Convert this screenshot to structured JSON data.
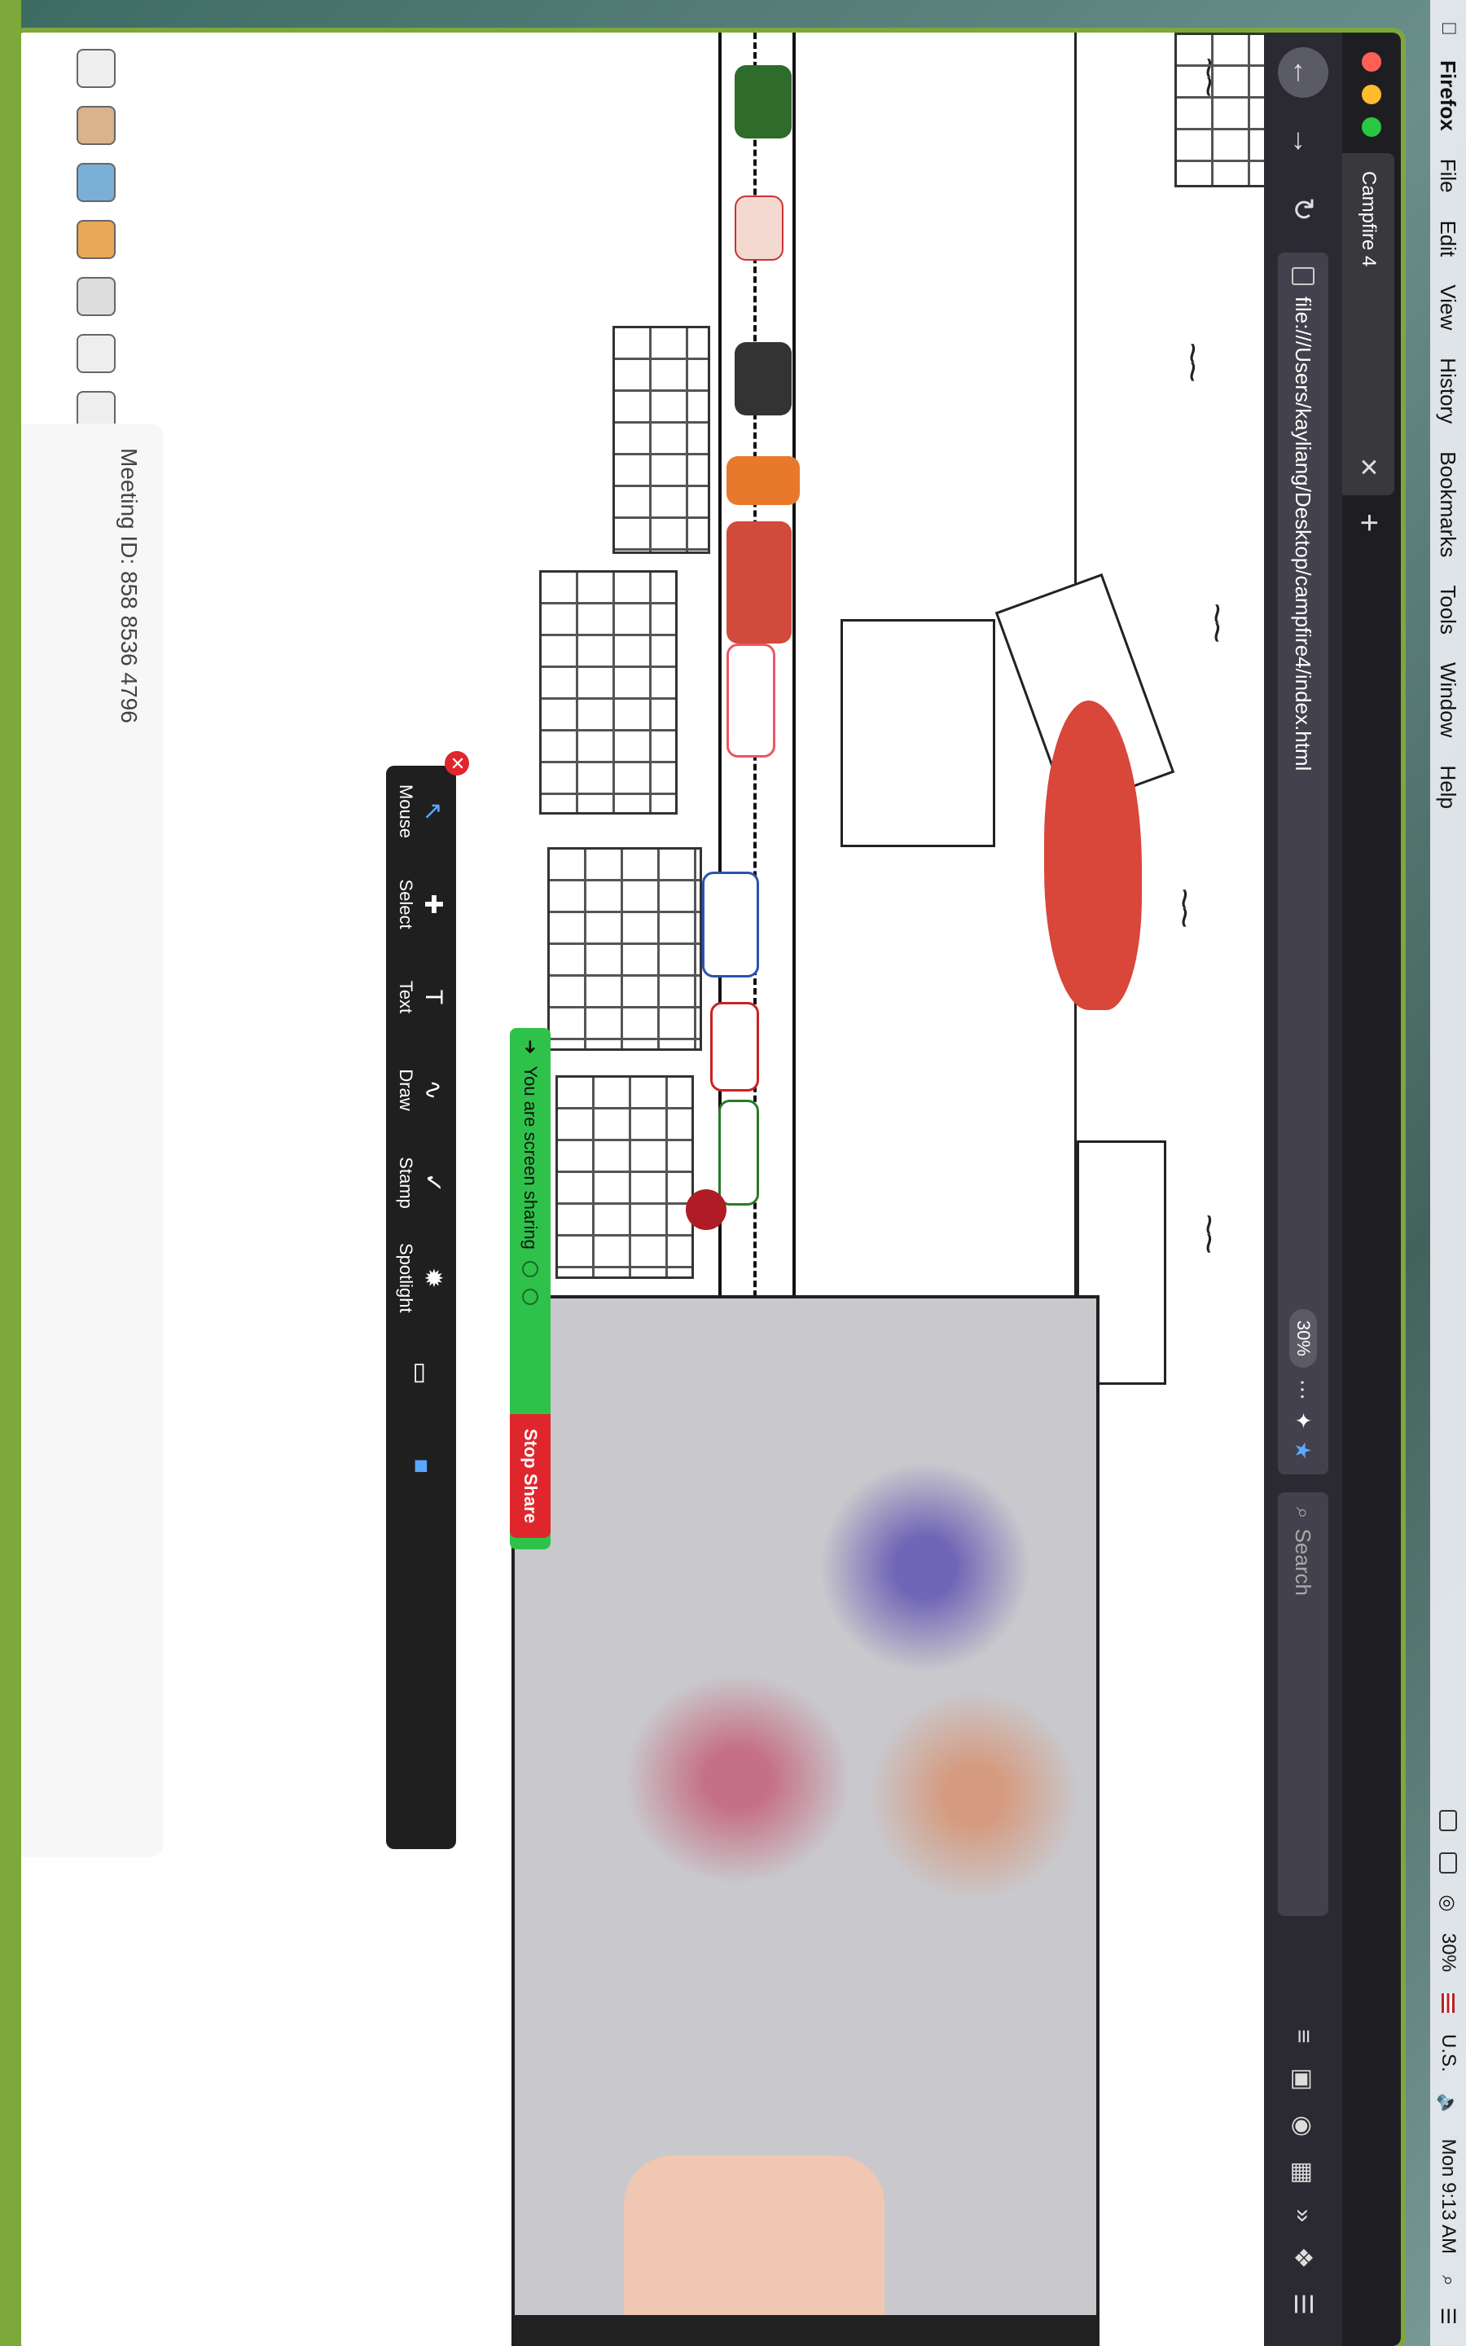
{
  "menubar": {
    "app": "Firefox",
    "items": [
      "File",
      "Edit",
      "View",
      "History",
      "Bookmarks",
      "Tools",
      "Window",
      "Help"
    ],
    "battery": "30%",
    "keyboard": "U.S.",
    "clock": "Mon 9:13 AM"
  },
  "browser": {
    "tab_title": "Campfire 4",
    "url": "file:///Users/kayliang/Desktop/campfire4/index.html",
    "zoom": "30%",
    "search_placeholder": "Search"
  },
  "annotation_toolbar": {
    "tools": [
      "Mouse",
      "Select",
      "Text",
      "Draw",
      "Stamp",
      "Spotlight"
    ]
  },
  "share_banner": {
    "status": "You are screen sharing",
    "stop_label": "Stop Share"
  },
  "meeting": {
    "id_text": "Meeting ID: 858 8536 4796"
  },
  "colors": {
    "firefox_dark": "#2b2a33",
    "share_green": "#2fc24b",
    "stop_red": "#e0262d",
    "window_border": "#7da83a"
  }
}
